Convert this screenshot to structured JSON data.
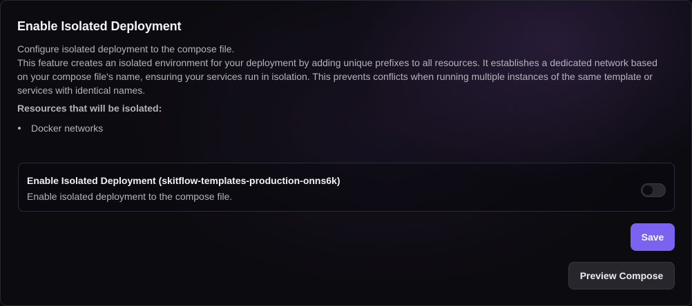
{
  "section": {
    "title": "Enable Isolated Deployment",
    "description_line1": "Configure isolated deployment to the compose file.",
    "description_line2": "This feature creates an isolated environment for your deployment by adding unique prefixes to all resources. It establishes a dedicated network based on your compose file's name, ensuring your services run in isolation. This prevents conflicts when running multiple instances of the same template or services with identical names.",
    "resources_heading": "Resources that will be isolated:",
    "resources": [
      "Docker networks"
    ]
  },
  "toggle": {
    "label": "Enable Isolated Deployment (skitflow-templates-production-onns6k)",
    "description": "Enable isolated deployment to the compose file.",
    "checked": false
  },
  "actions": {
    "save_label": "Save",
    "preview_label": "Preview Compose"
  },
  "colors": {
    "accent": "#7c62f0",
    "background": "#0c0b10",
    "border": "#2e2c36",
    "text_primary": "#f4f4f5",
    "text_muted": "#b4b3bb"
  }
}
